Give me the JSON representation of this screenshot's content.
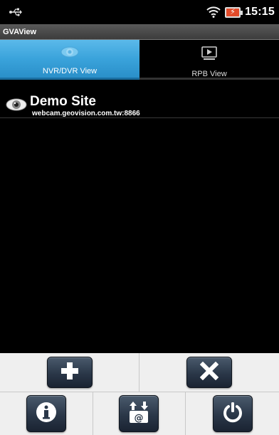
{
  "status_bar": {
    "time": "15:15",
    "icons": [
      "usb-debug-icon",
      "wifi-icon",
      "battery-charging-icon"
    ]
  },
  "app": {
    "title": "GVAView"
  },
  "tabs": [
    {
      "label": "NVR/DVR View",
      "icon": "eye-icon",
      "active": true
    },
    {
      "label": "RPB View",
      "icon": "playback-icon",
      "active": false
    }
  ],
  "sites": [
    {
      "name": "Demo Site",
      "host": "webcam.geovision.com.tw:8866",
      "icon": "eye-icon"
    }
  ],
  "toolbar": {
    "row1": [
      {
        "action": "add",
        "icon": "plus-icon"
      },
      {
        "action": "delete",
        "icon": "x-icon"
      }
    ],
    "row2": [
      {
        "action": "info",
        "icon": "info-icon"
      },
      {
        "action": "import-export",
        "icon": "import-export-icon"
      },
      {
        "action": "exit",
        "icon": "power-icon"
      }
    ]
  },
  "colors": {
    "tab_active": "#3aa3db",
    "button_bg": "#2a3748",
    "toolbar_bg": "#efefef",
    "battery": "#e34b2a"
  }
}
